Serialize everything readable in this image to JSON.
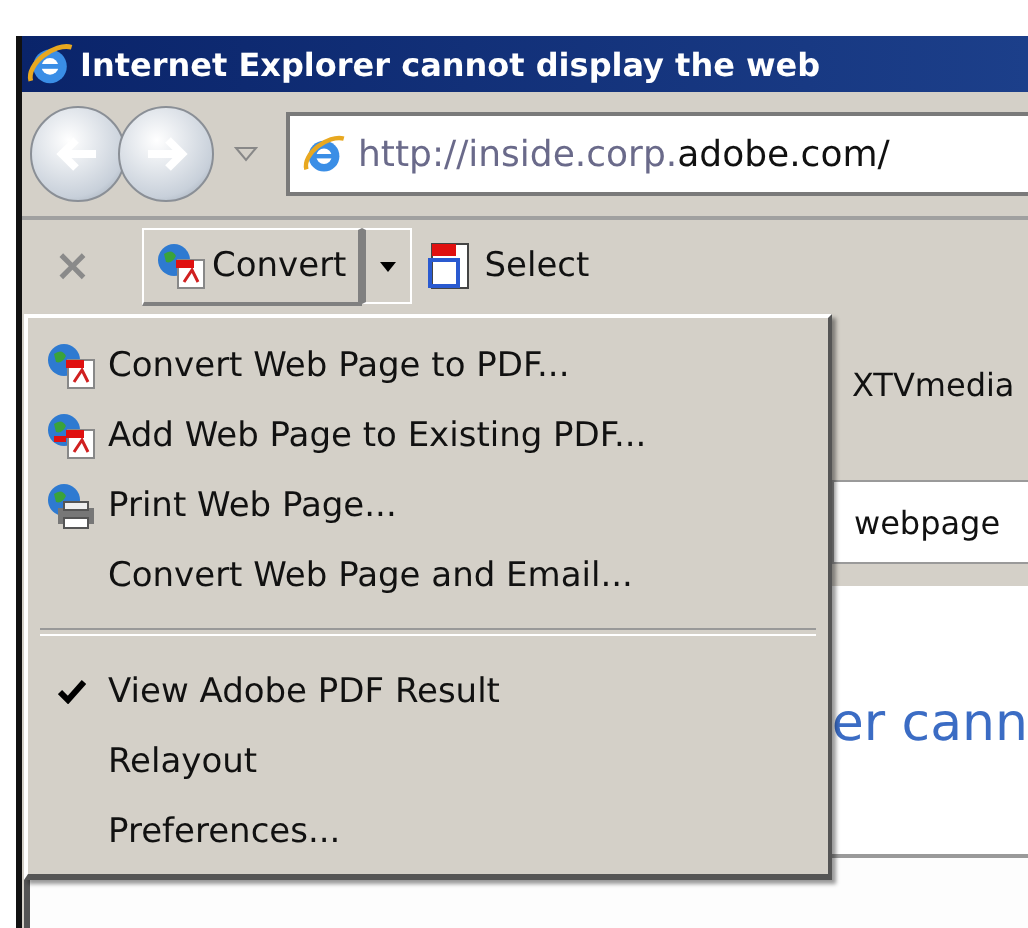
{
  "window": {
    "title": "Internet Explorer cannot display the web"
  },
  "address": {
    "prefix": "http://inside.corp.",
    "domain": "adobe.com/"
  },
  "toolbar": {
    "close": "×",
    "convert": "Convert",
    "select": "Select"
  },
  "links_bar": {
    "item": "XTVmedia"
  },
  "tabs": [
    {
      "label": "webpage",
      "selected": true
    }
  ],
  "page": {
    "heading": "er cann"
  },
  "menu": [
    {
      "kind": "command",
      "label": "Convert Web Page to PDF..."
    },
    {
      "kind": "command",
      "label": "Add Web Page to Existing PDF..."
    },
    {
      "kind": "command",
      "label": "Print Web Page..."
    },
    {
      "kind": "command",
      "label": "Convert Web Page and Email..."
    },
    {
      "kind": "separator"
    },
    {
      "kind": "toggle",
      "label": "View Adobe PDF Result",
      "checked": true
    },
    {
      "kind": "toggle",
      "label": "Relayout",
      "checked": false
    },
    {
      "kind": "command",
      "label": "Preferences..."
    }
  ]
}
